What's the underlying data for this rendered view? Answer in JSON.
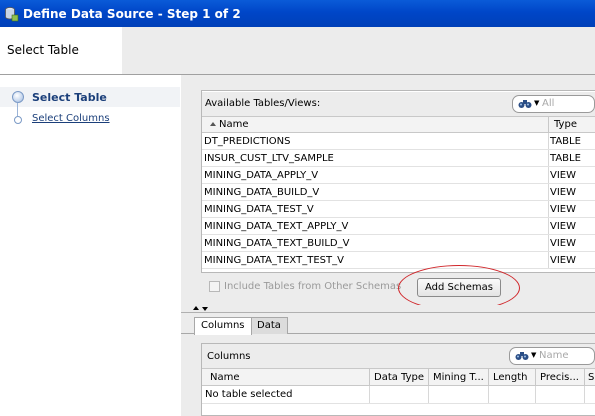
{
  "window": {
    "title": "Define Data Source - Step 1 of 2"
  },
  "header": {
    "title": "Select Table"
  },
  "nav": {
    "steps": [
      {
        "label": "Select Table"
      },
      {
        "label": "Select Columns"
      }
    ]
  },
  "available": {
    "label": "Available Tables/Views:",
    "search_placeholder": "All",
    "columns": [
      "Name",
      "Type"
    ],
    "rows": [
      {
        "name": "DT_PREDICTIONS",
        "type": "TABLE"
      },
      {
        "name": "INSUR_CUST_LTV_SAMPLE",
        "type": "TABLE"
      },
      {
        "name": "MINING_DATA_APPLY_V",
        "type": "VIEW"
      },
      {
        "name": "MINING_DATA_BUILD_V",
        "type": "VIEW"
      },
      {
        "name": "MINING_DATA_TEST_V",
        "type": "VIEW"
      },
      {
        "name": "MINING_DATA_TEXT_APPLY_V",
        "type": "VIEW"
      },
      {
        "name": "MINING_DATA_TEXT_BUILD_V",
        "type": "VIEW"
      },
      {
        "name": "MINING_DATA_TEXT_TEST_V",
        "type": "VIEW"
      }
    ]
  },
  "options": {
    "include_schemas_label": "Include Tables from Other Schemas",
    "add_schemas_label": "Add Schemas"
  },
  "tabs": [
    {
      "label": "Columns"
    },
    {
      "label": "Data"
    }
  ],
  "columns_panel": {
    "label": "Columns",
    "search_placeholder": "Name",
    "headers": [
      "Name",
      "Data Type",
      "Mining T...",
      "Length",
      "Precis...",
      "S"
    ],
    "empty_message": "No table selected"
  }
}
